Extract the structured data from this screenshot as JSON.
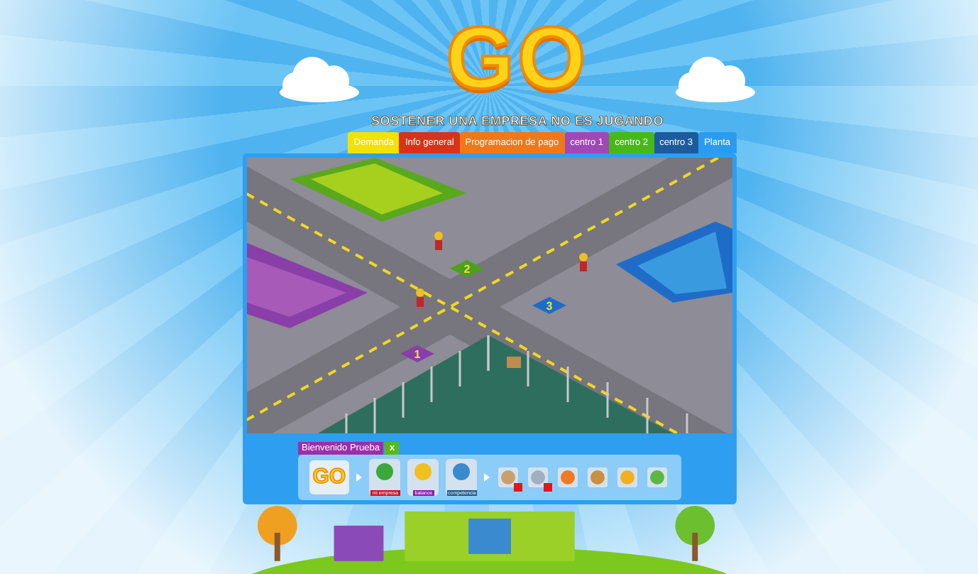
{
  "header": {
    "logo": "GO",
    "tagline": "SOSTENER UNA EMPRESA NO ES JUGANDO"
  },
  "tabs": [
    {
      "label": "Demanda",
      "color": "#f2e200"
    },
    {
      "label": "Info general",
      "color": "#d8321a"
    },
    {
      "label": "Programacion de pago",
      "color": "#f07818"
    },
    {
      "label": "centro 1",
      "color": "#a048b8"
    },
    {
      "label": "centro 2",
      "color": "#48b818"
    },
    {
      "label": "centro 3",
      "color": "#1c5c9c"
    },
    {
      "label": "Planta",
      "color": "#2a9cf0"
    }
  ],
  "map": {
    "plots": [
      {
        "label": "1",
        "color": "#8a3ea8"
      },
      {
        "label": "2",
        "color": "#4ea01c"
      },
      {
        "label": "3",
        "color": "#1e6cc8"
      }
    ]
  },
  "toolbar": {
    "welcome": "Bienvenido Prueba",
    "close": "x",
    "logo": "GO",
    "main_buttons": [
      {
        "label": "mi empresa",
        "color": "#c8142a"
      },
      {
        "label": "balance",
        "color": "#8a1fa8"
      },
      {
        "label": "competencia",
        "color": "#1d5a8c"
      }
    ],
    "tools": [
      {
        "alert": true
      },
      {
        "alert": true
      },
      {
        "alert": false
      },
      {
        "alert": false
      },
      {
        "alert": false
      },
      {
        "alert": false
      }
    ]
  }
}
